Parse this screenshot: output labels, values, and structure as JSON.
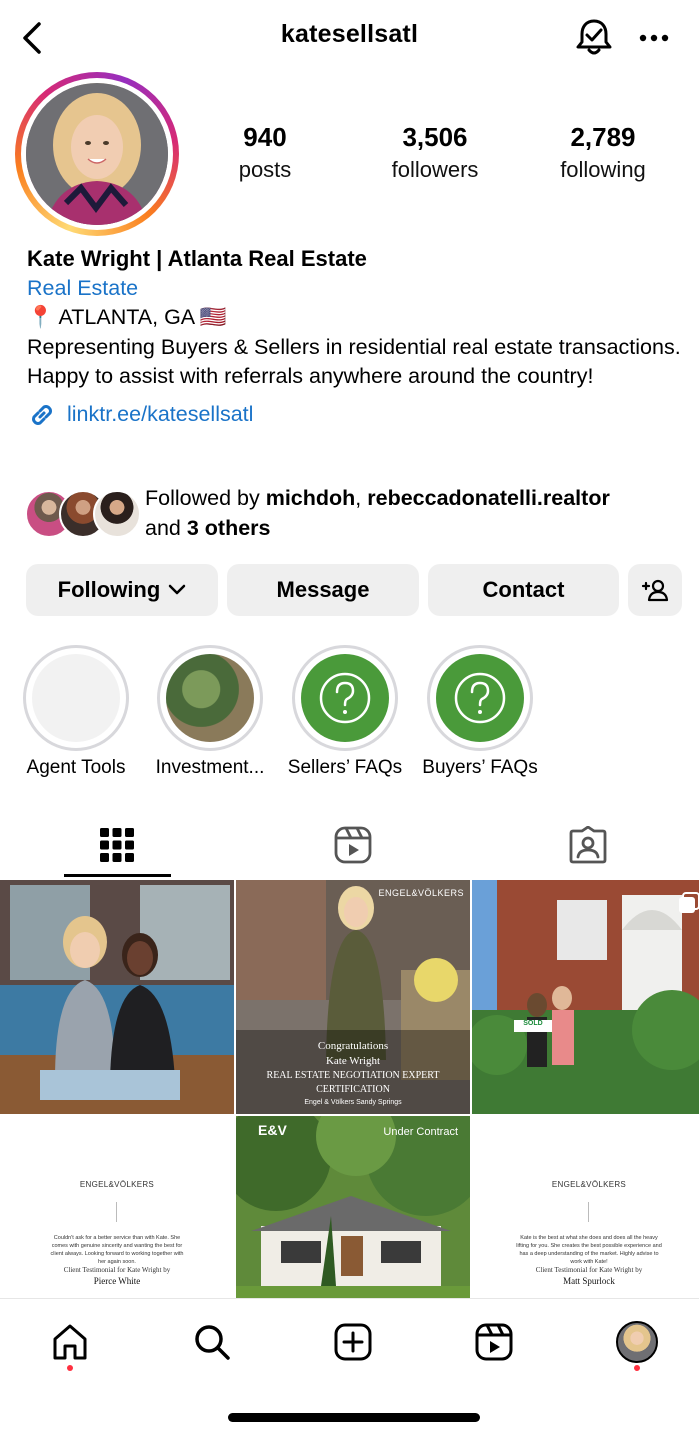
{
  "header": {
    "username": "katesellsatl"
  },
  "stats": [
    {
      "num": "940",
      "label": "posts"
    },
    {
      "num": "3,506",
      "label": "followers"
    },
    {
      "num": "2,789",
      "label": "following"
    }
  ],
  "bio": {
    "name": "Kate Wright | Atlanta Real Estate",
    "category": "Real Estate",
    "location": "📍 ATLANTA, GA 🇺🇸",
    "line1": "Representing Buyers & Sellers in residential real estate transactions.",
    "line2": "Happy to assist with referrals anywhere around the country!",
    "link": "linktr.ee/katesellsatl"
  },
  "followed_by": {
    "prefix": "Followed by ",
    "user1": "michdoh",
    "sep": ", ",
    "user2": "rebeccadonatelli.realtor",
    "and": "and ",
    "others": "3 others"
  },
  "actions": {
    "following": "Following",
    "message": "Message",
    "contact": "Contact"
  },
  "highlights": [
    {
      "label": "Agent Tools"
    },
    {
      "label": "Investment..."
    },
    {
      "label": "Sellers’ FAQs"
    },
    {
      "label": "Buyers’ FAQs"
    }
  ],
  "posts": {
    "p2_brand": "ENGEL&VÖLKERS",
    "p2_line1": "Congratulations",
    "p2_line2": "Kate Wright",
    "p2_line3": "REAL ESTATE NEGOTIATION EXPERT",
    "p2_line4": "CERTIFICATION",
    "p2_line5": "Engel & Völkers Sandy Springs",
    "p3_sign": "SOLD",
    "p4_brand": "ENGEL&VÖLKERS",
    "p4_quote": "Couldn't ask for a better service than with Kate. She comes with genuine sincerity and wanting the best for client always. Looking forward to working together with her again soon.",
    "p4_caption": "Client Testimonial for Kate Wright by",
    "p4_name": "Pierce White",
    "p5_logo": "E&V",
    "p5_tag": "Under Contract",
    "p6_brand": "ENGEL&VÖLKERS",
    "p6_quote": "Kate is the best at what she does and does all the heavy lifting for you. She creates the best possible experience and has a deep understanding of the market. Highly advise to work with Kate!",
    "p6_caption": "Client Testimonial for Kate Wright by",
    "p6_name": "Matt Spurlock"
  },
  "colors": {
    "link": "#1a73c8",
    "button_bg": "#efefef",
    "faq_green": "#4a9a3a",
    "notification": "#ff3040"
  },
  "icons": {
    "back": "chevron-left-icon",
    "bell": "bell-check-icon",
    "more": "ellipsis-icon",
    "link": "link-icon",
    "grid": "grid-icon",
    "reels": "reels-icon",
    "tagged": "tagged-icon"
  }
}
